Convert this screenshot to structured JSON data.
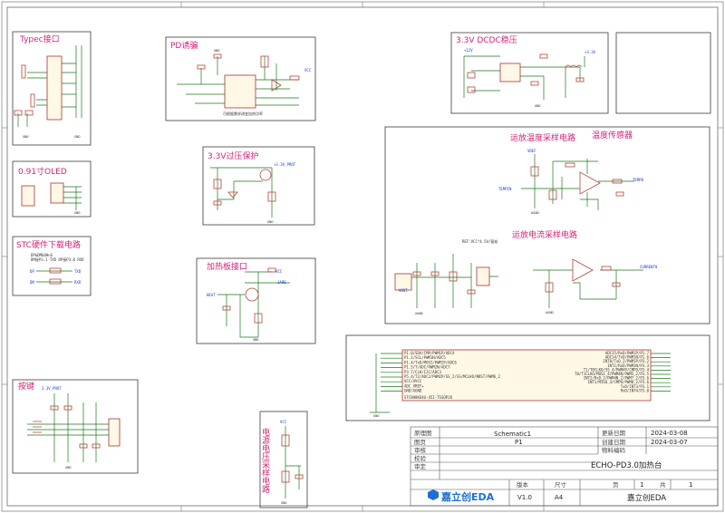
{
  "blocks": {
    "typec": "Typec接口",
    "pd": "PD诱骗",
    "dcdc": "3.3V DCDC稳压",
    "oled": "0.91寸OLED",
    "ovp": "3.3V过压保护",
    "stc": "STC硬件下载电路",
    "heater": "加热板接口",
    "opamp_temp": "运放温度采样电路",
    "temp_sensor": "温度传感器",
    "opamp_current": "运放电流采样电路",
    "keys": "按键",
    "vsample": "电源电压采样电路"
  },
  "labels": {
    "pd_note": "可根据需求改变加热功率",
    "stc_note1": "DP&DM&OHnG",
    "stc_note2": "DM接P3.1 TXD DP接P3.0 RXD",
    "opamp_ref": "REF:VCC*4.5V/基准",
    "mcu_footer": "STC8H8K64U-45I-TSSOP20",
    "mcu_left_pins": [
      "P1.0/SDA/CMP/PWM1P/ADC4",
      "P1.1/SCL/PWM1N/ADC5",
      "P1.4/TxD/MOSI/PWM2P/ADC6",
      "P1.5/T/ADC/PWM2N/ADC7",
      "P3.7/CLK/I2C/ADC3",
      "P5.4/T2/ADC2/PWM2P/SS_2/SS/MCLKO/NRST/PWM6_2",
      "VCC/AVCC",
      "ADC_VREF+",
      "GND/AGND"
    ],
    "mcu_right_pins": [
      "ADC15/RxD/PWM1P/P1.7",
      "ADC14/TxD/PWM1N/P1.6",
      "INT0/TxD_2/PWM1P/P3.2",
      "INT1/RxD/PWM1N/P3.3",
      "T1/T0CLKO/SS_4/PWM4P/CMPO/P3.4",
      "T0/T1CLKO/MOSI_4/PWM4N/PWM5_2/P3.5",
      "INT2/RxD_2/PWM4N_2/PWM7_2/P3.6",
      "INT1/MISO_4/CMPO/PWM8_2/P3.6",
      "TxD/INT3/P3.1",
      "RxD/INT4/P3.0"
    ],
    "ovp_net": "+3.3V_PROT",
    "key_net": "3.3V_PROT",
    "heat": "HEAT",
    "jare": "JARE",
    "vcc": "VCC",
    "gnd": "GND",
    "agnd": "AGND",
    "vref": "VREF",
    "tempin": "TEMPIN",
    "temp0": "TEMP0",
    "current0": "CURRENT0",
    "vout": "VOUT",
    "v12": "+12V",
    "v33": "+3.3V",
    "txd": "TXD",
    "rxd": "RXD",
    "dp": "DP",
    "dm": "DM"
  },
  "title_block": {
    "r1_label": "原理图",
    "r1_value": "Schematic1",
    "r2_label": "图页",
    "r2_value": "P1",
    "r3_label": "审核",
    "r4_label": "校验",
    "r5_label": "审定",
    "update_label": "更新日期",
    "update_value": "2024-03-08",
    "create_label": "创建日期",
    "create_value": "2024-03-07",
    "part_label": "物料编码",
    "project": "ECHO-PD3.0加热台",
    "version_label": "版本",
    "size_label": "尺寸",
    "page_label": "页",
    "page_num": "1",
    "total_label": "共",
    "total_num": "1",
    "version_value": "V1.0",
    "size_value": "A4",
    "company": "嘉立创EDA",
    "logo": "嘉立创EDA"
  },
  "colors": {
    "title_text": "#d4237a",
    "wire": "#1a7a1a",
    "component": "#b8423a",
    "netlabel": "#1a3ccf",
    "logo": "#1d6fd1"
  }
}
